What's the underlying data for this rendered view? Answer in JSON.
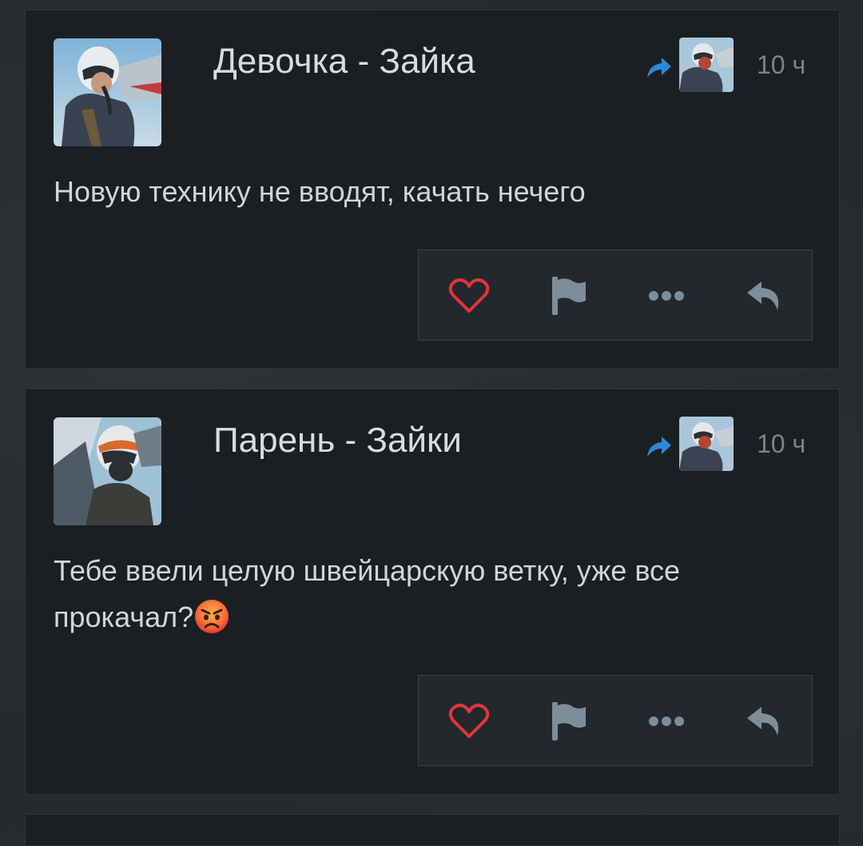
{
  "colors": {
    "card_bg": "#1b1f22",
    "like": "#e1353b",
    "share": "#2b8ad6",
    "icon": "#7d8d99",
    "text": "#d2d5d7",
    "time": "#7c848a"
  },
  "posts": [
    {
      "author": "Девочка - Зайка",
      "time": "10 ч",
      "text": "Новую технику не вводят, качать нечего",
      "emoji": null,
      "actions": [
        "heart-icon",
        "flag-icon",
        "more-icon",
        "reply-icon"
      ]
    },
    {
      "author": "Парень - Зайки",
      "time": "10 ч",
      "text": "Тебе ввели целую швейцарскую ветку, уже все прокачал?",
      "emoji": "angry-face-emoji",
      "actions": [
        "heart-icon",
        "flag-icon",
        "more-icon",
        "reply-icon"
      ]
    }
  ]
}
